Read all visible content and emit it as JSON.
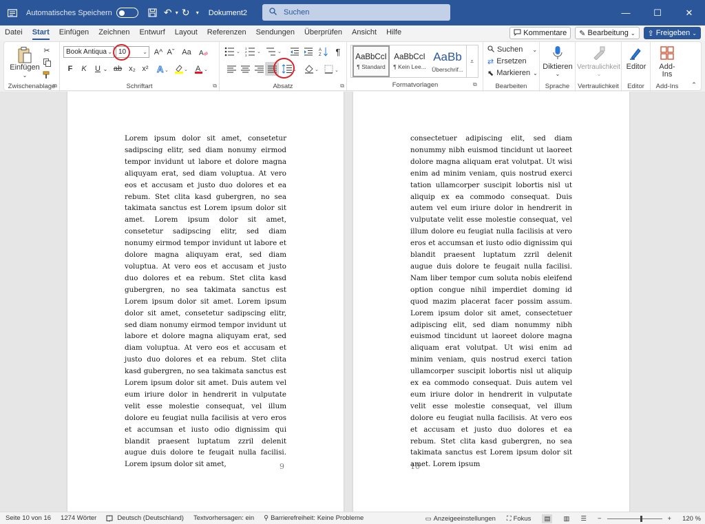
{
  "titlebar": {
    "autosave_label": "Automatisches Speichern",
    "document_name": "Dokument2",
    "search_placeholder": "Suchen",
    "undo_dropdown": "▾",
    "more": "▾"
  },
  "tabs": [
    "Datei",
    "Start",
    "Einfügen",
    "Zeichnen",
    "Entwurf",
    "Layout",
    "Referenzen",
    "Sendungen",
    "Überprüfen",
    "Ansicht",
    "Hilfe"
  ],
  "active_tab": "Start",
  "tabbar_right": {
    "comments": "Kommentare",
    "editing": "Bearbeitung",
    "share": "Freigeben"
  },
  "ribbon": {
    "clipboard": {
      "paste": "Einfügen",
      "label": "Zwischenablage"
    },
    "font": {
      "name": "Book Antiqua",
      "size": "10",
      "bold": "F",
      "italic": "K",
      "underline": "U",
      "strike": "ab",
      "subscript": "x₂",
      "superscript": "x²",
      "grow": "A^",
      "shrink": "Aˇ",
      "case": "Aa",
      "label": "Schriftart"
    },
    "paragraph": {
      "label": "Absatz"
    },
    "styles": {
      "items": [
        {
          "sample": "AaBbCcI",
          "name": "¶ Standard"
        },
        {
          "sample": "AaBbCcI",
          "name": "¶ Kein Lee..."
        },
        {
          "sample": "AaBb",
          "name": "Überschrif..."
        }
      ],
      "label": "Formatvorlagen"
    },
    "editing": {
      "find": "Suchen",
      "replace": "Ersetzen",
      "select": "Markieren",
      "label": "Bearbeiten"
    },
    "voice": {
      "dictate": "Diktieren",
      "label": "Sprache"
    },
    "sensitivity": {
      "button": "Vertraulichkeit",
      "label": "Vertraulichkeit"
    },
    "editor": {
      "button": "Editor",
      "label": "Editor"
    },
    "addins": {
      "button_line1": "Add-",
      "button_line2": "Ins",
      "label": "Add-Ins"
    }
  },
  "pages": [
    {
      "number": "9",
      "text": "Lorem ipsum dolor sit amet, consetetur sadipscing elitr, sed diam nonumy eirmod tempor invidunt ut labore et dolore magna aliquyam erat, sed diam voluptua. At vero eos et accusam et justo duo dolores et ea rebum. Stet clita kasd gubergren, no sea takimata sanctus est Lorem ipsum dolor sit amet. Lorem ipsum dolor sit amet, consetetur sadipscing elitr, sed diam nonumy eirmod tempor invidunt ut labore et dolore magna aliquyam erat, sed diam voluptua. At vero eos et accusam et justo duo dolores et ea rebum. Stet clita kasd gubergren, no sea takimata sanctus est Lorem ipsum dolor sit amet. Lorem ipsum dolor sit amet, consetetur sadipscing elitr, sed diam nonumy eirmod tempor invidunt ut labore et dolore magna aliquyam erat, sed diam voluptua. At vero eos et accusam et justo duo dolores et ea rebum. Stet clita kasd gubergren, no sea takimata sanctus est Lorem ipsum dolor sit amet. Duis autem vel eum iriure dolor in hendrerit in vulputate velit esse molestie consequat, vel illum dolore eu feugiat nulla facilisis at vero eros et accumsan et iusto odio dignissim qui blandit praesent luptatum zzril delenit augue duis dolore te feugait nulla facilisi. Lorem ipsum dolor sit amet,"
    },
    {
      "number": "10",
      "text": "consectetuer adipiscing elit, sed diam nonummy nibh euismod tincidunt ut laoreet dolore magna aliquam erat volutpat. Ut wisi enim ad minim veniam, quis nostrud exerci tation ullamcorper suscipit lobortis nisl ut aliquip ex ea commodo consequat. Duis autem vel eum iriure dolor in hendrerit in vulputate velit esse molestie consequat, vel illum dolore eu feugiat nulla facilisis at vero eros et accumsan et iusto odio dignissim qui blandit praesent luptatum zzril delenit augue duis dolore te feugait nulla facilisi. Nam liber tempor cum soluta nobis eleifend option congue nihil imperdiet doming id quod mazim placerat facer possim assum. Lorem ipsum dolor sit amet, consectetuer adipiscing elit, sed diam nonummy nibh euismod tincidunt ut laoreet dolore magna aliquam erat volutpat. Ut wisi enim ad minim veniam, quis nostrud exerci tation ullamcorper suscipit lobortis nisl ut aliquip ex ea commodo consequat. Duis autem vel eum iriure dolor in hendrerit in vulputate velit esse molestie consequat, vel illum dolore eu feugiat nulla facilisis. At vero eos et accusam et justo duo dolores et ea rebum. Stet clita kasd gubergren, no sea takimata sanctus est Lorem ipsum dolor sit amet. Lorem ipsum"
    }
  ],
  "statusbar": {
    "page": "Seite 10 von 16",
    "words": "1274 Wörter",
    "language": "Deutsch (Deutschland)",
    "predictions": "Textvorhersagen: ein",
    "accessibility": "Barrierefreiheit: Keine Probleme",
    "display_settings": "Anzeigeeinstellungen",
    "focus": "Fokus",
    "zoom_minus": "−",
    "zoom_plus": "+",
    "zoom": "120 %",
    "zoom_level": 0.6
  },
  "colors": {
    "brand": "#2b579a",
    "highlight_circle": "#d8222a",
    "font_color": "#e81123",
    "highlight_color": "#ffff00"
  }
}
